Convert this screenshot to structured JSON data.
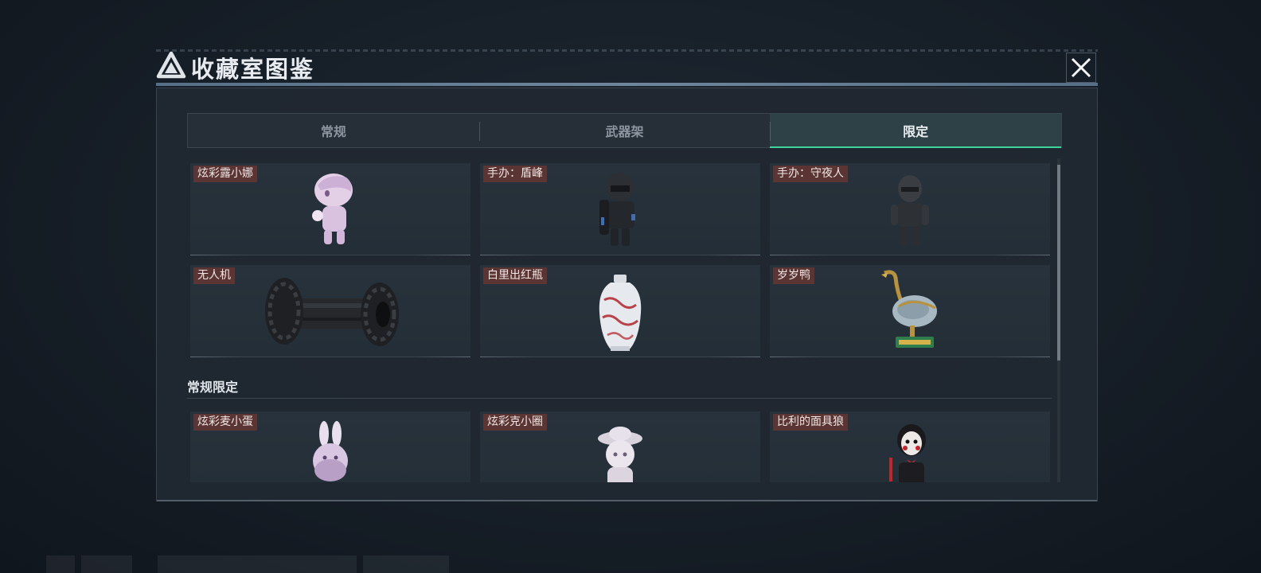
{
  "modal": {
    "title": "收藏室图鉴",
    "close_icon": "close-icon",
    "logo_icon": "triangle-logo-icon"
  },
  "tabs": [
    {
      "label": "常规",
      "active": false
    },
    {
      "label": "武器架",
      "active": false
    },
    {
      "label": "限定",
      "active": true
    }
  ],
  "colors": {
    "accent": "#3fd59a",
    "label_bg": "#5a3533",
    "panel_bg": "#202831"
  },
  "items": [
    {
      "label": "炫彩露小娜",
      "icon": "pink-chibi-figure-icon"
    },
    {
      "label": "手办：盾峰",
      "icon": "armored-soldier-figure-icon"
    },
    {
      "label": "手办：守夜人",
      "icon": "dark-soldier-figure-icon"
    },
    {
      "label": "无人机",
      "icon": "drone-icon"
    },
    {
      "label": "白里出红瓶",
      "icon": "porcelain-vase-icon"
    },
    {
      "label": "岁岁鸭",
      "icon": "bronze-duck-icon"
    }
  ],
  "section": {
    "title": "常规限定",
    "items": [
      {
        "label": "炫彩麦小蛋",
        "icon": "bunny-figure-icon"
      },
      {
        "label": "炫彩克小圈",
        "icon": "hat-girl-figure-icon"
      },
      {
        "label": "比利的面具狼",
        "icon": "puppet-mask-figure-icon"
      }
    ]
  }
}
